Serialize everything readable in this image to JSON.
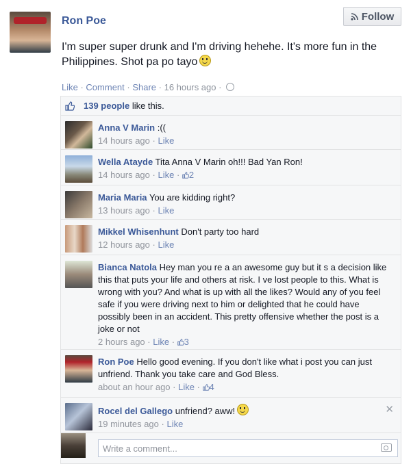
{
  "post": {
    "author": "Ron Poe",
    "follow_label": "Follow",
    "text": "I'm super super drunk and I'm driving hehehe. It's more fun in the Philippines. Shot pa po tayo",
    "actions": {
      "like": "Like",
      "comment": "Comment",
      "share": "Share",
      "time": "16 hours ago"
    }
  },
  "likes": {
    "count_text": "139 people",
    "suffix": " like this."
  },
  "comments": [
    {
      "author": "Anna V Marin",
      "text": ":((",
      "time": "14 hours ago",
      "like": "Like",
      "likes": ""
    },
    {
      "author": "Wella Atayde",
      "text": "Tita Anna V Marin oh!!! Bad   Yan Ron!",
      "time": "14 hours ago",
      "like": "Like",
      "likes": "2"
    },
    {
      "author": "Maria Maria",
      "text": "You are kidding right?",
      "time": "13 hours ago",
      "like": "Like",
      "likes": ""
    },
    {
      "author": "Mikkel Whisenhunt",
      "text": "Don't party too hard",
      "time": "12 hours ago",
      "like": "Like",
      "likes": ""
    },
    {
      "author": "Bianca Natola",
      "text": "Hey man you re a an awesome guy but it s a decision like this that puts your life and others at risk. I ve lost people to this. What is wrong with you? And what is up with all the likes? Would any of you feel safe if you were driving next to him or delighted that he could have possibly been in an accident. This pretty offensive whether the post is a joke or not",
      "time": "2 hours ago",
      "like": "Like",
      "likes": "3"
    },
    {
      "author": "Ron Poe",
      "text": "Hello good evening. If you don't like what i post you can just unfriend. Thank you take care and God Bless.",
      "time": "about an hour ago",
      "like": "Like",
      "likes": "4"
    },
    {
      "author": "Rocel del Gallego",
      "text": "unfriend? aww!",
      "time": "19 minutes ago",
      "like": "Like",
      "likes": ""
    }
  ],
  "composer": {
    "placeholder": "Write a comment..."
  },
  "colors": {
    "link": "#3b5998",
    "meta_link": "#6d84b4",
    "meta_text": "#90949c",
    "panel": "#f6f7f8"
  }
}
